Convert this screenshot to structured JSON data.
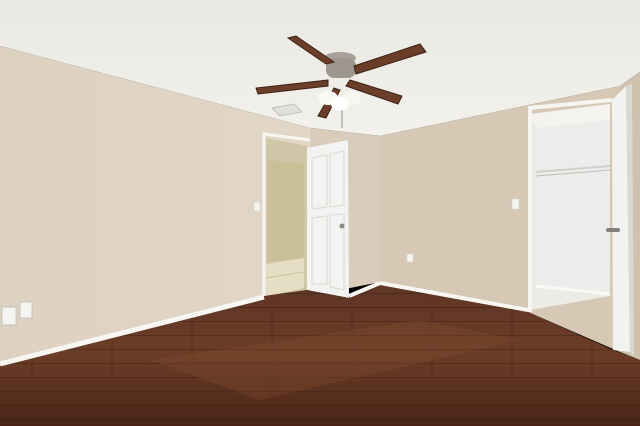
{
  "scene": {
    "description_items": [
      "empty-bedroom",
      "ceiling-fan",
      "hardwood-floor",
      "open-doors",
      "walk-in-closet"
    ],
    "colors": {
      "ceiling": "#ecebe6",
      "wall_left": "#dfd3c2",
      "wall_back": "#d8cbb9",
      "wall_right": "#d6c8b5",
      "baseboard": "#f7f6f2",
      "door": "#f4f4f2",
      "floor_dark": "#3e2016",
      "floor_mid": "#5c3422",
      "floor_light": "#7a4a30",
      "fan_blade": "#6a3e28",
      "fan_metal": "#a8a29a",
      "closet_wall": "#ecebe7"
    }
  }
}
